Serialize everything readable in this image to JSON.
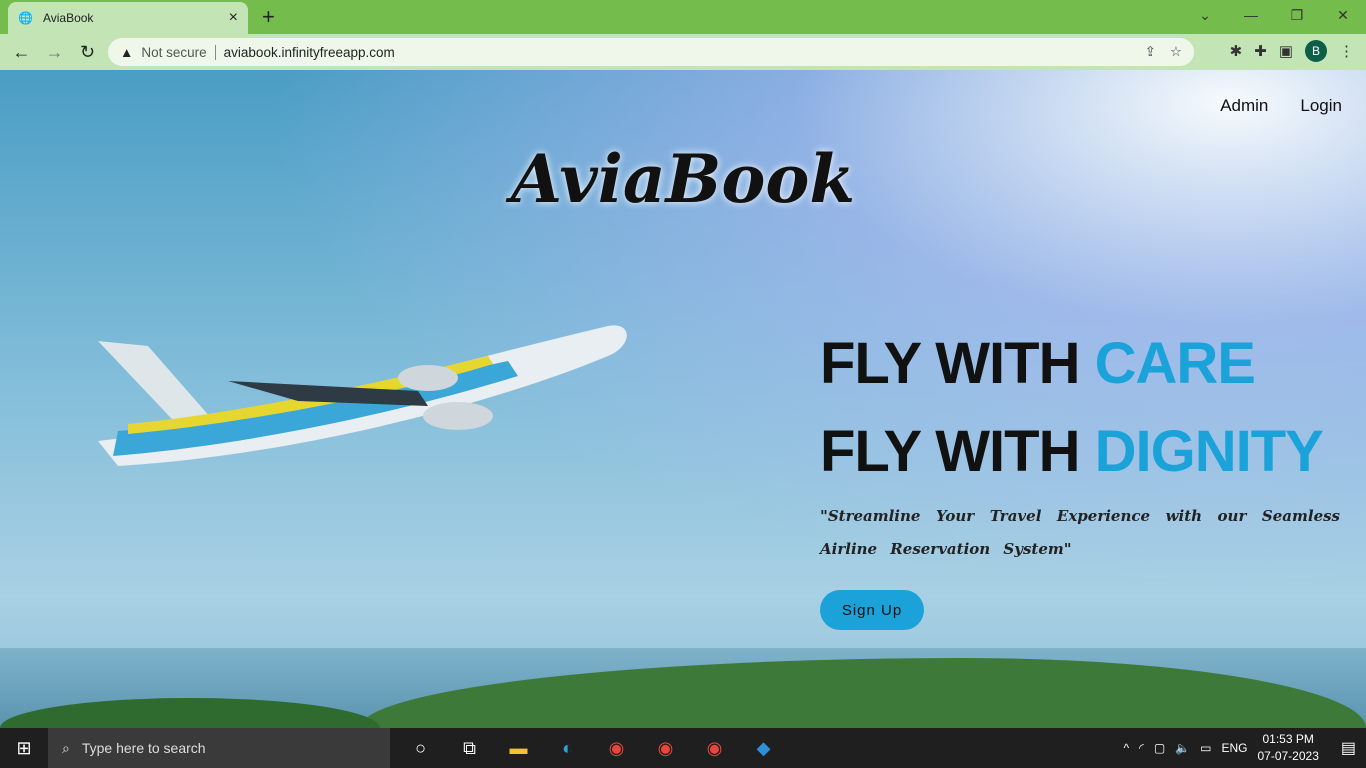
{
  "browser": {
    "tab_title": "AviaBook",
    "not_secure": "Not secure",
    "url": "aviabook.infinityfreeapp.com",
    "profile": "B"
  },
  "page": {
    "nav": [
      "Admin",
      "Login"
    ],
    "logo": "AviaBook",
    "headline1": "FLY WITH ",
    "headline1_accent": "CARE",
    "headline2": "FLY WITH ",
    "headline2_accent": "DIGNITY",
    "tagline": "\"Streamline Your Travel Experience with our Seamless Airline Reservation System\"",
    "signup": "Sign Up",
    "accent": "#1aa2d9"
  },
  "taskbar": {
    "search_placeholder": "Type here to search",
    "lang": "ENG",
    "time": "01:53 PM",
    "date": "07-07-2023"
  }
}
